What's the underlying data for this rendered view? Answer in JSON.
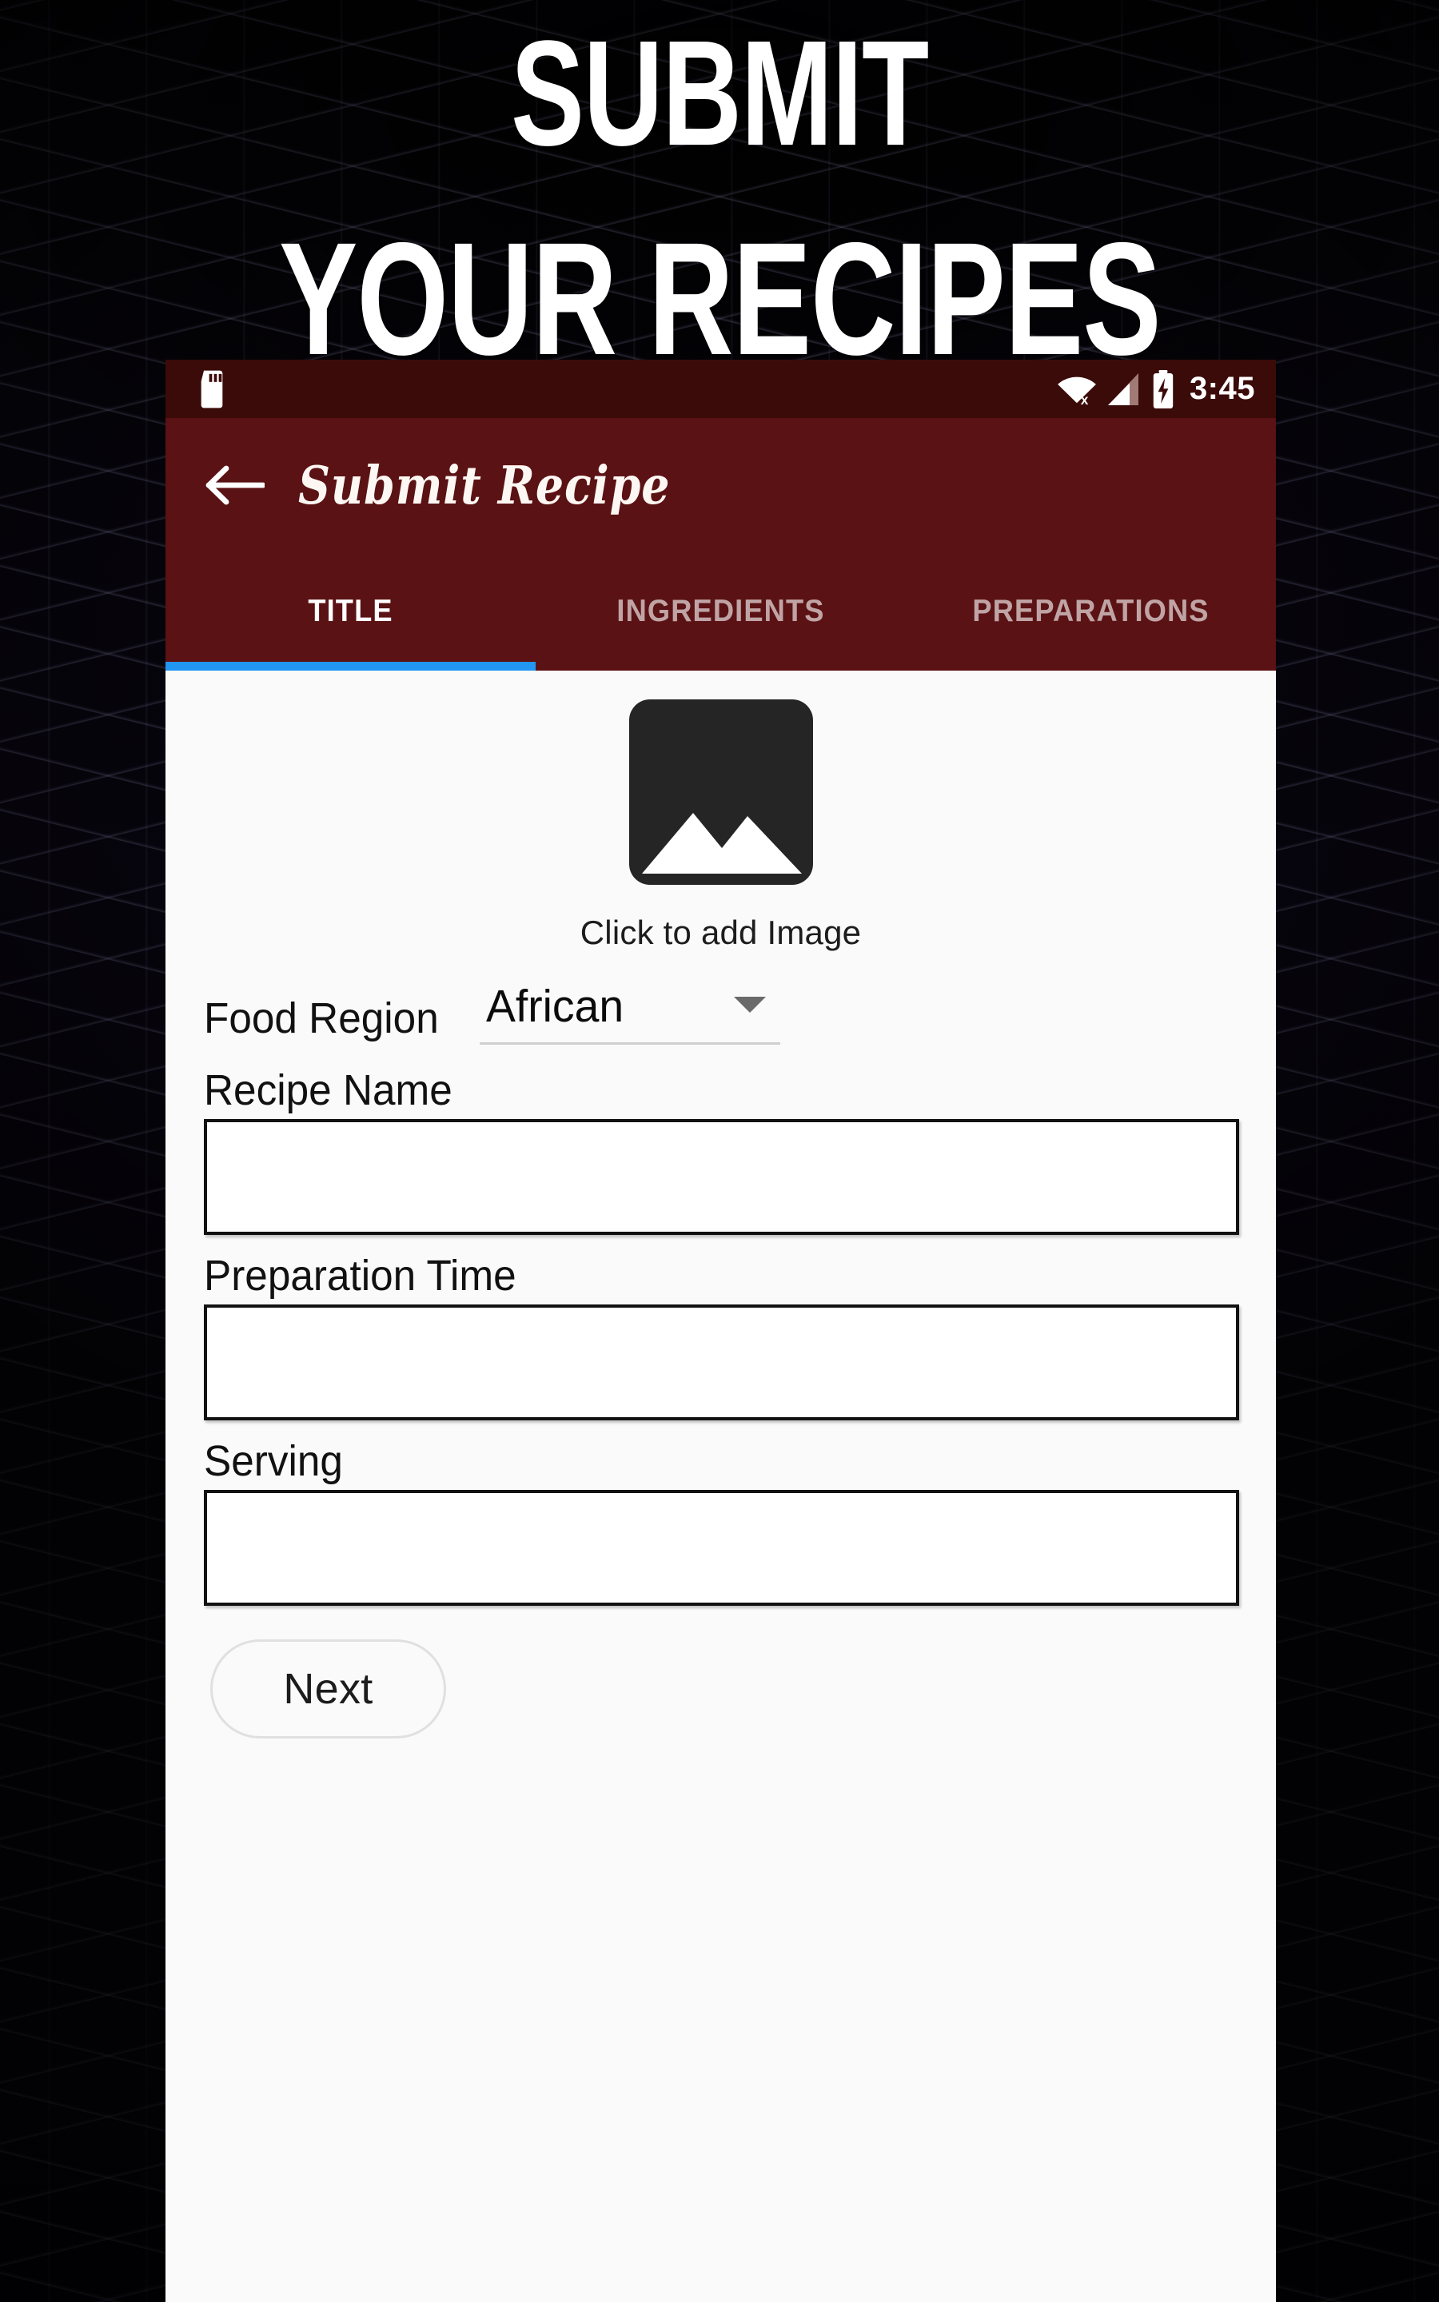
{
  "banner": {
    "line1": "SUBMIT",
    "line2": "YOUR RECIPES"
  },
  "colors": {
    "status_bar": "#3b0b09",
    "app_bar": "#5b1214",
    "tab_indicator": "#2196f3",
    "content_bg": "#fafafa",
    "backdrop": "#05030a"
  },
  "status_bar": {
    "sd_card_icon": "sd-card-icon",
    "wifi_icon": "wifi-off-icon",
    "signal_icon": "cell-signal-icon",
    "battery_icon": "battery-charging-icon",
    "time": "3:45"
  },
  "app_bar": {
    "back_icon": "back-arrow-icon",
    "title": "Submit Recipe"
  },
  "tabs": [
    {
      "label": "TITLE",
      "active": true
    },
    {
      "label": "INGREDIENTS",
      "active": false
    },
    {
      "label": "PREPARATIONS",
      "active": false
    }
  ],
  "form": {
    "image_picker": {
      "icon": "image-placeholder-icon",
      "caption": "Click to add Image"
    },
    "food_region": {
      "label": "Food Region",
      "value": "African",
      "caret_icon": "chevron-down-icon"
    },
    "fields": [
      {
        "label": "Recipe Name",
        "value": "",
        "placeholder": ""
      },
      {
        "label": "Preparation Time",
        "value": "",
        "placeholder": ""
      },
      {
        "label": "Serving",
        "value": "",
        "placeholder": ""
      }
    ],
    "next_label": "Next"
  }
}
